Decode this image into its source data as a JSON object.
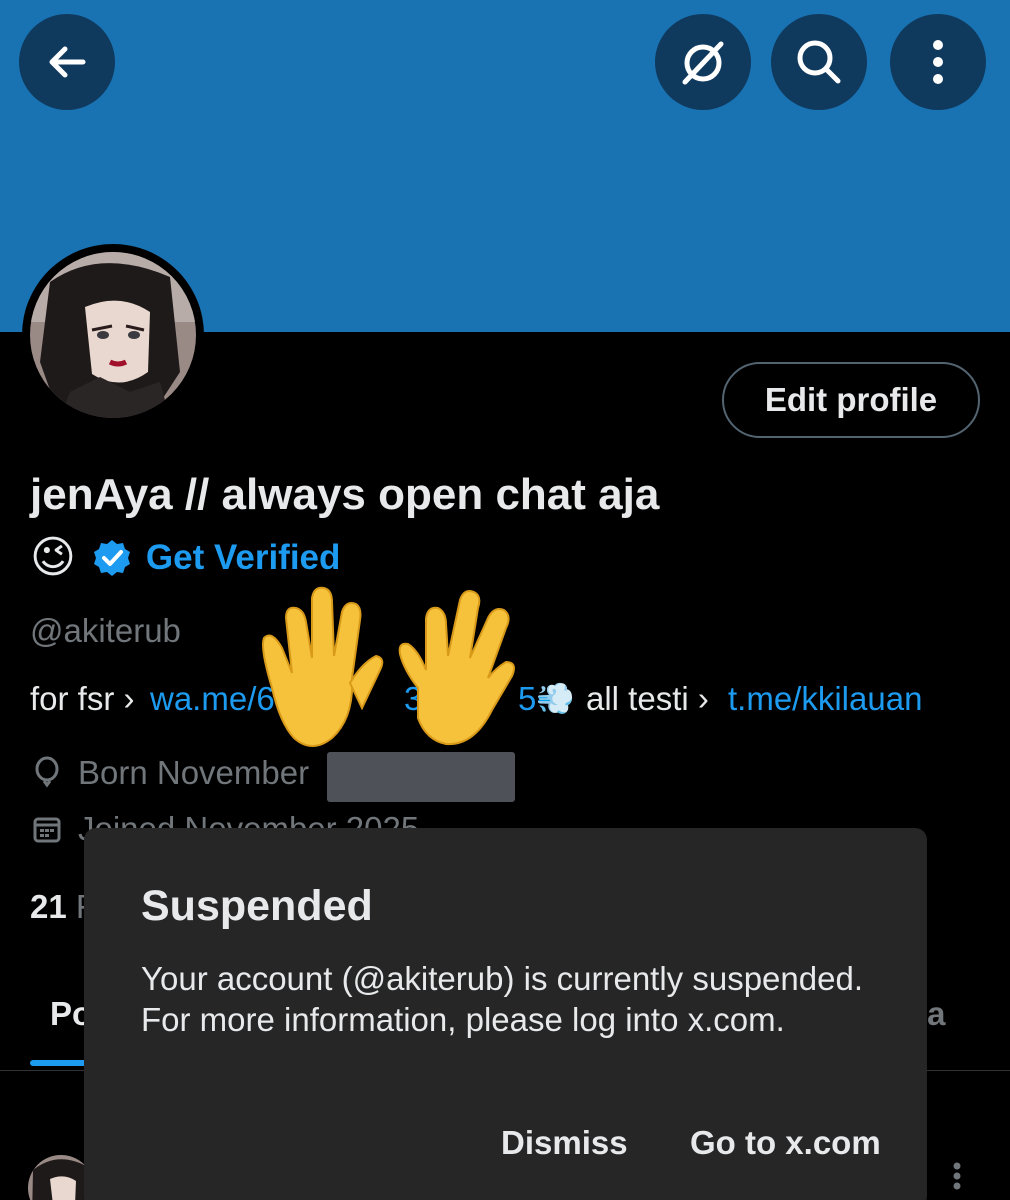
{
  "header": {
    "back_icon": "arrow-left-icon",
    "grok_icon": "grok-icon",
    "search_icon": "search-icon",
    "more_icon": "more-vertical-icon",
    "banner_color": "#1972b2"
  },
  "profile": {
    "edit_label": "Edit profile",
    "display_name": "jenAya // always open chat aja",
    "name_emoji": "😉",
    "verified_icon": "verified-badge-icon",
    "get_verified": "Get Verified",
    "handle": "@akiterub",
    "bio": {
      "prefix": "for fsr ›",
      "link1": "wa.me/6",
      "link1_mid": "3",
      "link1_end": "5",
      "dash_emoji": "💨",
      "middle": "all testi ›",
      "link2": "t.me/kkilauan"
    },
    "born_label": "Born November",
    "joined_label": "Joined November 2025",
    "following_count": "21",
    "following_label": "F"
  },
  "tabs": {
    "posts": "Po",
    "media": "ia"
  },
  "overlay_emoji": "🙌",
  "modal": {
    "title": "Suspended",
    "body": "Your account (@akiterub) is currently suspended. For more information, please log into x.com.",
    "dismiss": "Dismiss",
    "go_to": "Go to x.com"
  },
  "colors": {
    "link": "#1d9bf0",
    "modal_bg": "#262627",
    "secondary_text": "#71767b"
  }
}
